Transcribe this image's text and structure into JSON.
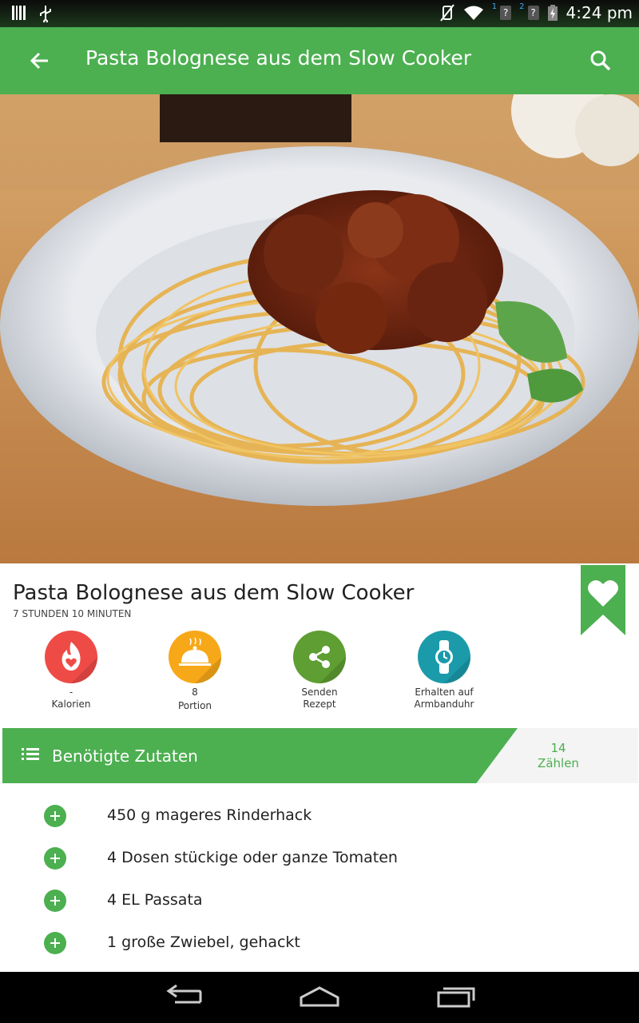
{
  "status_bar": {
    "time": "4:24 pm",
    "sim1_label": "1",
    "sim2_label": "2",
    "unknown_glyph": "?",
    "icons": [
      "barcode-icon",
      "usb-icon",
      "vibrate-off-icon",
      "wifi-icon",
      "sim-unknown-icon",
      "battery-charging-icon"
    ]
  },
  "app_bar": {
    "title": "Pasta Bolognese aus dem Slow Cooker",
    "back_icon": "arrow-left-icon",
    "search_icon": "search-icon",
    "color": "#4caf50"
  },
  "recipe": {
    "title": "Pasta Bolognese aus dem Slow Cooker",
    "duration": "7 STUNDEN 10 MINUTEN",
    "favorite_icon": "heart-bookmark-icon"
  },
  "actions": [
    {
      "value": "-",
      "label": "Kalorien",
      "icon": "flame-heart-icon",
      "color": "#ef4b46"
    },
    {
      "value": "8",
      "label": "Portion",
      "icon": "serving-cloche-icon",
      "color": "#f7a818"
    },
    {
      "line1": "Senden",
      "line2": "Rezept",
      "icon": "share-icon",
      "color": "#5e9e32"
    },
    {
      "line1": "Erhalten auf",
      "line2": "Armbanduhr",
      "icon": "smartwatch-icon",
      "color": "#1b9aaa"
    }
  ],
  "ingredients_tab": {
    "label": "Benötigte Zutaten",
    "count": "14",
    "count_label": "Zählen",
    "icon": "list-icon"
  },
  "ingredients": [
    "450 g mageres Rinderhack",
    "4 Dosen stückige oder ganze Tomaten",
    "4 EL Passata",
    "1 große Zwiebel, gehackt"
  ],
  "nav_bar": {
    "icons": [
      "back-nav-icon",
      "home-nav-icon",
      "recents-nav-icon"
    ]
  }
}
